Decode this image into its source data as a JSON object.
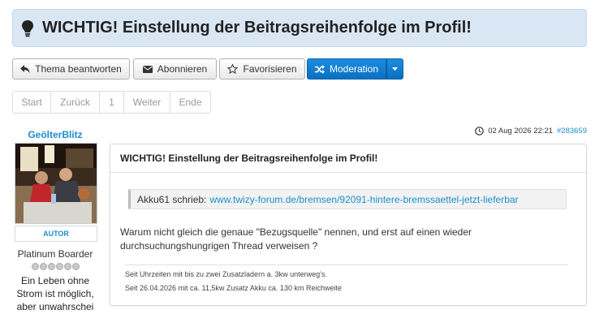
{
  "topic": {
    "title": "WICHTIG! Einstellung der Beitragsreihenfolge im Profil!",
    "icon": "lightbulb-icon"
  },
  "toolbar": {
    "reply_label": "Thema beantworten",
    "subscribe_label": "Abonnieren",
    "favorite_label": "Favorisieren",
    "moderation_label": "Moderation",
    "primary_color": "#1180d4"
  },
  "pagination": {
    "first": "Start",
    "prev": "Zurück",
    "current": "1",
    "next": "Weiter",
    "last": "Ende"
  },
  "post": {
    "author": {
      "name": "GeölterBlitz",
      "rank_badge": "AUTOR",
      "rank_title": "Platinum Boarder",
      "signature_text": "Ein Leben ohne Strom ist möglich, aber unwahrschei"
    },
    "timestamp": "02 Aug 2026 22:21",
    "post_id": "#283659",
    "subject": "WICHTIG! Einstellung der Beitragsreihenfolge im Profil!",
    "quote": {
      "author": "Akku61 schrieb:",
      "link": "www.twizy-forum.de/bremsen/92091-hintere-bremssaettel-jetzt-lieferbar"
    },
    "body": "Warum nicht gleich die genaue \"Bezugsquelle\" nennen, und erst auf einen wieder durchsuchungshungrigen Thread verweisen ?",
    "signature": [
      "Seit Uhrzeiten mit bis zu zwei Zusatzladern a. 3kw unterweg's.",
      "Seit 26.04.2026 mit ca. 11,5kw Zusatz Akku ca. 130 km Reichweite"
    ]
  }
}
